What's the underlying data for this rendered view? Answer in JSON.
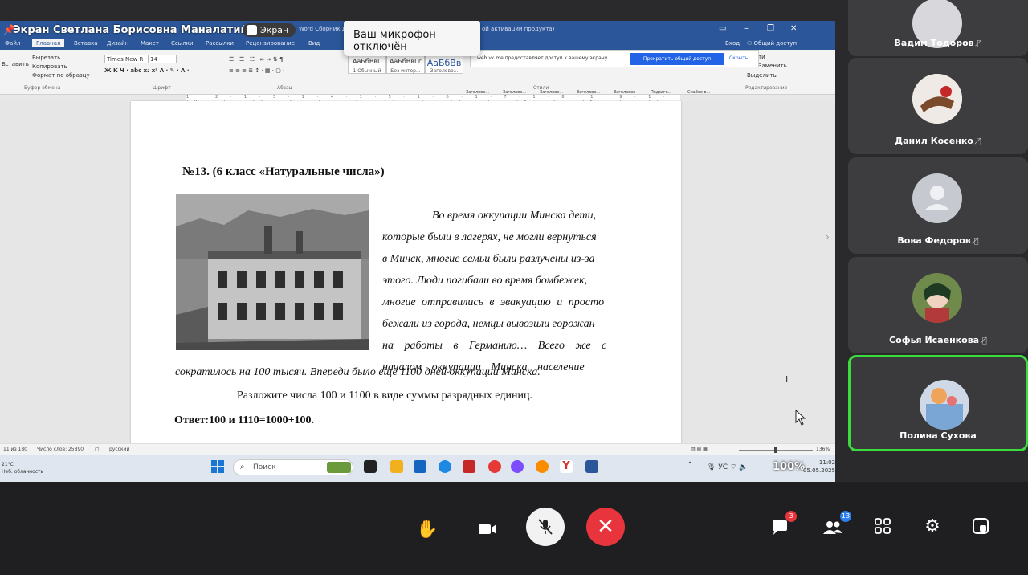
{
  "screen_share": {
    "owner_label": "Экран Светлана Борисовна Маналатий",
    "pill_label": "Экран",
    "doc_title": "Word Сборник Д...",
    "activation_text": "ой активации продукта)",
    "mic_toast": "Ваш микрофон отключён"
  },
  "word": {
    "tabs": [
      "Файл",
      "Главная",
      "Вставка",
      "Дизайн",
      "Макет",
      "Ссылки",
      "Рассылки",
      "Рецензирование",
      "Вид"
    ],
    "signin": "Вход",
    "share": "Общий доступ",
    "clipboard": {
      "paste": "Вставить",
      "cut": "Вырезать",
      "copy": "Копировать",
      "format": "Формат по образцу",
      "group": "Буфер обмена"
    },
    "font": {
      "name": "Times New R",
      "size": "14",
      "group": "Шрифт"
    },
    "paragraph_group": "Абзац",
    "styles": [
      {
        "preview": "АаБбВвГ",
        "label": "1 Обычный"
      },
      {
        "preview": "АаБбВвГг",
        "label": "Без интер..."
      },
      {
        "preview": "АаБбВв",
        "label": "Заголово..."
      }
    ],
    "styles_row": [
      "Заголово...",
      "Заголово...",
      "Заголово...",
      "Заголово...",
      "Заголово...",
      "Заголовок",
      "Подзаго...",
      "Слабое в..."
    ],
    "styles_group": "Стили",
    "editing": {
      "find": "Найти",
      "replace": "Заменить",
      "select": "Выделить",
      "group": "Редактирование"
    },
    "vk_bar": {
      "text": "web.vk.me предоставляет доступ к вашему экрану.",
      "stop": "Прекратить общий доступ",
      "hide": "Скрыть"
    },
    "ruler": "1 · 2 · 1 · 3 · 1 · 4 · 1 · 5 · 1 · 6 · 1 · 7 · 1 · 8 · 1 · 9 · 1 · 10 · 1 · 11 · 1 · 12 · 1 · 13 · 1 · 14 · 1 · 15 · 1 · 16 · 1 · 17 · 18",
    "status": {
      "page": "11 из 180",
      "words": "Число слов: 25890",
      "lang": "русский",
      "zoom": "136%"
    }
  },
  "document": {
    "title": "№13. (6 класс «Натуральные числа»)",
    "story_lines": [
      "Во время оккупации Минска дети,",
      "которые были в лагерях, не могли вернуться",
      "в Минск, многие семьи были разлучены из-за",
      "этого. Люди погибали во время бомбежек,",
      "многие отправились в эвакуацию и просто",
      "бежали из города, немцы вывозили горожан",
      "на работы в Германию… Всего же с",
      "началом оккупации Минска население"
    ],
    "story_last": "сократилось на 100 тысяч. Впереди было еще 1100 дней оккупации Минска.",
    "task": "Разложите числа 100 и 1100  в виде  суммы разрядных единиц.",
    "answer": "Ответ:100 и 1110=1000+100."
  },
  "taskbar": {
    "weather_temp": "21°C",
    "weather_desc": "Неб. облачность",
    "search_placeholder": "Поиск",
    "tray_text": "УС",
    "zoom_overlay": "100%",
    "time": "11:02",
    "date": "05.05.2025"
  },
  "participants": [
    {
      "name": "Вадим Тодоров",
      "avatar": "photo"
    },
    {
      "name": "Данил Косенко",
      "avatar": "photo"
    },
    {
      "name": "Вова Федоров",
      "avatar": "placeholder"
    },
    {
      "name": "Софья Исаенкова",
      "avatar": "photo"
    },
    {
      "name": "Полина Сухова",
      "avatar": "photo",
      "speaking": true
    }
  ],
  "controls": {
    "chat_badge": "3",
    "people_badge": "13"
  },
  "colors": {
    "word_blue": "#2b579a",
    "hangup_red": "#e8353d",
    "speaking_green": "#3ddc3d",
    "vk_blue": "#2364e6"
  }
}
